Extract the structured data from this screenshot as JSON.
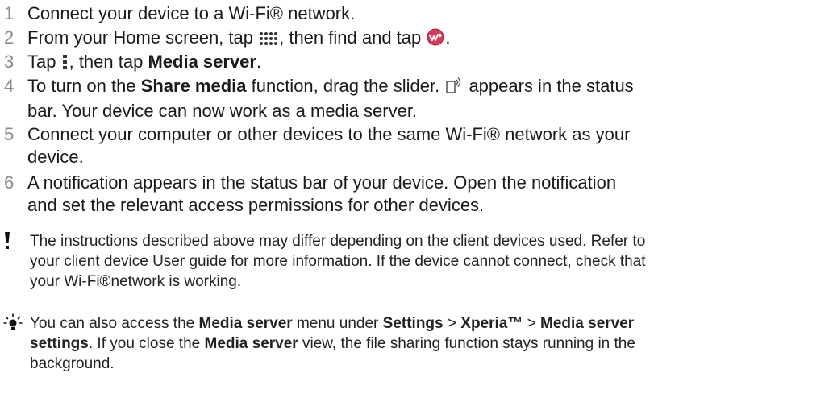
{
  "steps": [
    {
      "num": "1",
      "a": "Connect your device to a Wi-Fi® network."
    },
    {
      "num": "2",
      "a": "From your Home screen, tap ",
      "b": ", then find and tap ",
      "c": "."
    },
    {
      "num": "3",
      "a": "Tap ",
      "b": ", then tap ",
      "bold1": "Media server",
      "c": "."
    },
    {
      "num": "4",
      "a": "To turn on the ",
      "bold1": "Share media",
      "b": " function, drag the slider. ",
      "c": " appears in the status",
      "d": "bar. Your device can now work as a media server."
    },
    {
      "num": "5",
      "a": "Connect your computer or other devices to the same Wi-Fi® network as your",
      "b": "device."
    },
    {
      "num": "6",
      "a": "A notification appears in the status bar of your device. Open the notification",
      "b": "and set the relevant access permissions for other devices."
    }
  ],
  "note": {
    "icon": "exclamation-icon",
    "l1": "The instructions described above may differ depending on the client devices used. Refer to",
    "l2": "your client device User guide for more information. If the device cannot connect, check that",
    "l3": "your Wi-Fi®network is working."
  },
  "tip": {
    "icon": "lightbulb-icon",
    "a": "You can also access the ",
    "b1": "Media server",
    "a2": " menu under ",
    "b2": "Settings",
    "a3": " > ",
    "b3": "Xperia™",
    "a4": " > ",
    "b4": "Media server",
    "b5": "settings",
    "a5": ". If you close the ",
    "b6": "Media server",
    "a6": " view, the file sharing function stays running in the",
    "a7": "background."
  },
  "icons": {
    "apps": "apps-grid-icon",
    "walkman": "walkman-app-icon",
    "menu": "menu-icon",
    "share": "share-media-status-icon"
  },
  "colors": {
    "text": "#1a1a1a",
    "step_number": "#8a8a8a",
    "walkman": "#d83a5a"
  }
}
